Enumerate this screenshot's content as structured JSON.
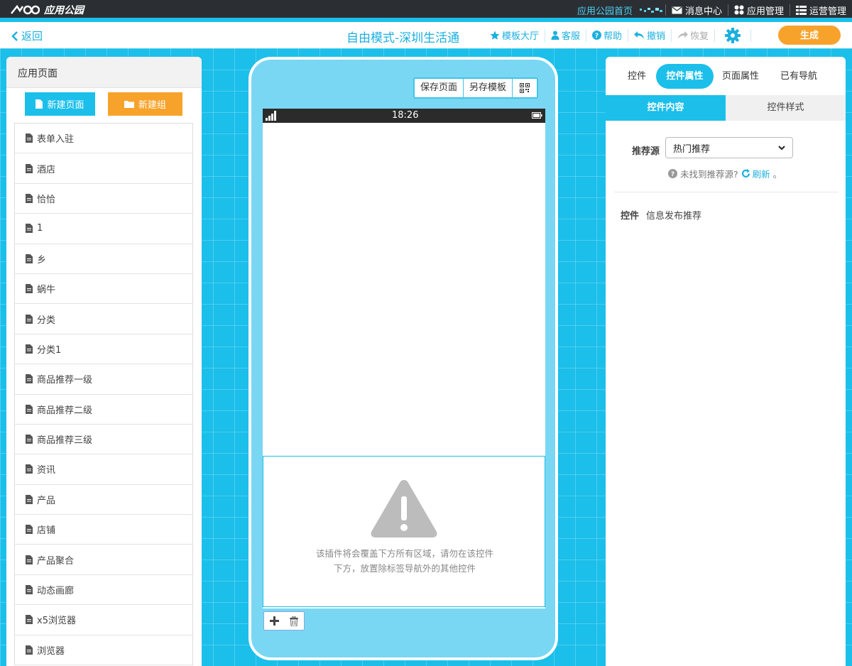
{
  "topbar": {
    "logo_text": "应用公园",
    "links": [
      {
        "label": "应用公园首页"
      },
      {
        "label": "消息中心"
      },
      {
        "label": "应用管理"
      },
      {
        "label": "运营管理"
      }
    ]
  },
  "toolbar": {
    "back_label": "返回",
    "title": "自由模式-深圳生活通",
    "tools": [
      {
        "label": "模板大厅",
        "icon": "star-icon"
      },
      {
        "label": "客服",
        "icon": "user-icon"
      },
      {
        "label": "帮助",
        "icon": "help-icon"
      },
      {
        "label": "撤销",
        "icon": "undo-icon"
      },
      {
        "label": "恢复",
        "icon": "redo-icon"
      }
    ],
    "generate_label": "生成"
  },
  "left_panel": {
    "title": "应用页面",
    "new_page_label": "新建页面",
    "new_group_label": "新建组",
    "pages": [
      "表单入驻",
      "酒店",
      "恰恰",
      "1",
      "乡",
      "蜗牛",
      "分类",
      "分类1",
      "商品推荐一级",
      "商品推荐二级",
      "商品推荐三级",
      "资讯",
      "产品",
      "店铺",
      "产品聚合",
      "动态画廊",
      "x5浏览器",
      "浏览器"
    ]
  },
  "phone": {
    "save_page_label": "保存页面",
    "save_template_label": "另存模板",
    "time": "18:26",
    "warning_text_1": "该插件将会覆盖下方所有区域，请勿在该控件",
    "warning_text_2": "下方，放置除标签导航外的其他控件"
  },
  "right_panel": {
    "tabs": [
      "控件",
      "控件属性",
      "页面属性",
      "已有导航"
    ],
    "active_tab": 1,
    "subtabs": [
      "控件内容",
      "控件样式"
    ],
    "source_label": "推荐源",
    "source_value": "热门推荐",
    "hint_text": "未找到推荐源?",
    "refresh_label": "刷新",
    "hint_end": "。",
    "control_label": "控件",
    "control_value": "信息发布推荐"
  },
  "colors": {
    "accent": "#1bbfea",
    "orange": "#f7a32b",
    "dark": "#2b2f33"
  }
}
